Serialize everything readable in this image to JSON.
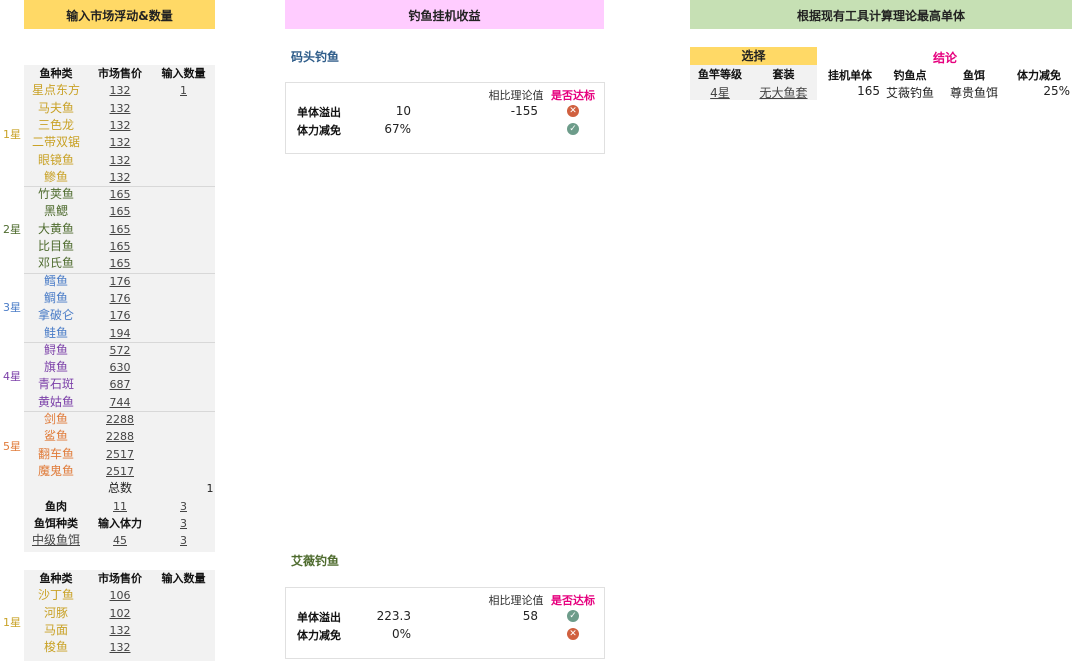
{
  "banners": {
    "left": "输入市场浮动&数量",
    "mid": "钓鱼挂机收益",
    "right": "根据现有工具计算理论最高单体"
  },
  "colors": {
    "yellow": "#ffd966",
    "pink": "#ffccff",
    "green": "#c6e0b4",
    "star1": "#c9a227",
    "star2": "#4e6b2e",
    "star3": "#4a7cc7",
    "star4": "#7b3fa8",
    "star5": "#e07b39",
    "magenta": "#e6007e"
  },
  "table1": {
    "headers": [
      "鱼种类",
      "市场售价",
      "输入数量"
    ],
    "groups": [
      {
        "star": "1星",
        "color": "star1",
        "fish": [
          [
            "星点东方",
            "132",
            "1"
          ],
          [
            "马夫鱼",
            "132",
            ""
          ],
          [
            "三色龙",
            "132",
            ""
          ],
          [
            "二带双锯",
            "132",
            ""
          ],
          [
            "眼镜鱼",
            "132",
            ""
          ],
          [
            "鲹鱼",
            "132",
            ""
          ]
        ]
      },
      {
        "star": "2星",
        "color": "star2",
        "fish": [
          [
            "竹荚鱼",
            "165",
            ""
          ],
          [
            "黑鳃",
            "165",
            ""
          ],
          [
            "大黄鱼",
            "165",
            ""
          ],
          [
            "比目鱼",
            "165",
            ""
          ],
          [
            "邓氏鱼",
            "165",
            ""
          ]
        ]
      },
      {
        "star": "3星",
        "color": "star3",
        "fish": [
          [
            "鳕鱼",
            "176",
            ""
          ],
          [
            "鲷鱼",
            "176",
            ""
          ],
          [
            "拿破仑",
            "176",
            ""
          ],
          [
            "鲑鱼",
            "194",
            ""
          ]
        ]
      },
      {
        "star": "4星",
        "color": "star4",
        "fish": [
          [
            "鲟鱼",
            "572",
            ""
          ],
          [
            "旗鱼",
            "630",
            ""
          ],
          [
            "青石斑",
            "687",
            ""
          ],
          [
            "黄姑鱼",
            "744",
            ""
          ]
        ]
      },
      {
        "star": "5星",
        "color": "star5",
        "fish": [
          [
            "剑鱼",
            "2288",
            ""
          ],
          [
            "鲨鱼",
            "2288",
            ""
          ],
          [
            "翻车鱼",
            "2517",
            ""
          ],
          [
            "魔鬼鱼",
            "2517",
            ""
          ]
        ]
      }
    ],
    "total_label": "总数",
    "total_value": "1",
    "meat_label": "鱼肉",
    "meat_price": "11",
    "meat_qty": "3",
    "bait_header": "鱼饵种类",
    "stamina_header": "输入体力",
    "bait_header_value": "3",
    "bait_name": "中级鱼饵",
    "bait_stamina": "45",
    "bait_qty": "3"
  },
  "table2": {
    "headers": [
      "鱼种类",
      "市场售价",
      "输入数量"
    ],
    "groups": [
      {
        "star": "1星",
        "color": "star1",
        "fish": [
          [
            "沙丁鱼",
            "106",
            ""
          ],
          [
            "河豚",
            "102",
            ""
          ],
          [
            "马面",
            "132",
            ""
          ],
          [
            "梭鱼",
            "132",
            ""
          ]
        ]
      }
    ]
  },
  "cards": [
    {
      "title": "码头钓鱼",
      "title_color": "#2f5d8a",
      "compare_header": "相比理论值",
      "pass_header": "是否达标",
      "rows": [
        {
          "label": "单体溢出",
          "value": "10",
          "compare": "-155",
          "pass": false
        },
        {
          "label": "体力减免",
          "value": "67%",
          "compare": "",
          "pass": true
        }
      ]
    },
    {
      "title": "艾薇钓鱼",
      "title_color": "#4e6b2e",
      "compare_header": "相比理论值",
      "pass_header": "是否达标",
      "rows": [
        {
          "label": "单体溢出",
          "value": "223.3",
          "compare": "58",
          "pass": true
        },
        {
          "label": "体力减免",
          "value": "0%",
          "compare": "",
          "pass": false
        }
      ]
    }
  ],
  "select": {
    "header": "选择",
    "rod_label": "鱼竿等级",
    "suit_label": "套装",
    "rod_value": "4星",
    "suit_value": "无大鱼套"
  },
  "conclusion": {
    "header": "结论",
    "cols": [
      "挂机单体",
      "钓鱼点",
      "鱼饵",
      "体力减免"
    ],
    "values": [
      "165",
      "艾薇钓鱼",
      "尊贵鱼饵",
      "25%"
    ]
  }
}
